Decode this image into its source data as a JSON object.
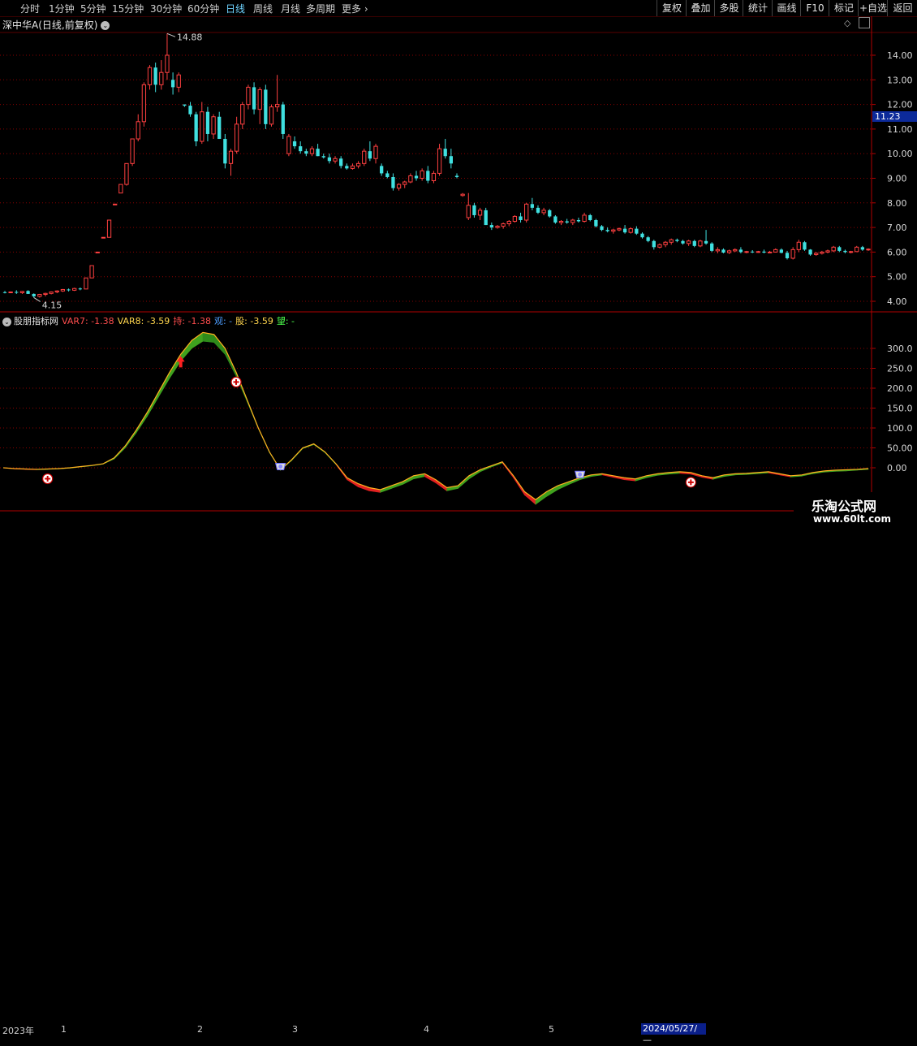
{
  "toolbar": {
    "periods": [
      "分时",
      "1分钟",
      "5分钟",
      "15分钟",
      "30分钟",
      "60分钟",
      "日线",
      "周线",
      "月线",
      "多周期",
      "更多"
    ],
    "active_period": "日线",
    "more_arrow": "›",
    "right_buttons": [
      "复权",
      "叠加",
      "多股",
      "统计",
      "画线",
      "F10",
      "标记",
      "+自选",
      "返回"
    ]
  },
  "chart": {
    "title": "深中华A(日线,前复权)",
    "title_btn": "⌄",
    "price_high_label": "14.88",
    "price_low_label": "4.15",
    "current_price": "11.23",
    "y_ticks": [
      "14.00",
      "13.00",
      "12.00",
      "11.00",
      "10.00",
      "9.00",
      "8.00",
      "7.00",
      "6.00",
      "5.00",
      "4.00"
    ]
  },
  "indicator": {
    "name": "股朋指标网",
    "values": [
      {
        "label": "VAR7: -1.38",
        "color": "#ff4d4d"
      },
      {
        "label": "VAR8: -3.59",
        "color": "#ffd54d"
      },
      {
        "label": "持: -1.38",
        "color": "#ff4d4d"
      },
      {
        "label": "观: -",
        "color": "#4d9dff"
      },
      {
        "label": "股: -3.59",
        "color": "#ffd54d"
      },
      {
        "label": "望: -",
        "color": "#4dff4d"
      }
    ],
    "y_ticks": [
      "300.0",
      "250.0",
      "200.0",
      "150.0",
      "100.0",
      "50.00",
      "0.00"
    ]
  },
  "timeline": {
    "labels": [
      "2023年",
      "1",
      "2",
      "3",
      "4",
      "5"
    ],
    "date": "2024/05/27/—"
  },
  "watermark": {
    "line1": "乐淘公式网",
    "line2": "www.60lt.com"
  },
  "colors": {
    "up": "#ff4040",
    "down": "#40e0e0",
    "grid": "#8b0000",
    "axis": "#b00000"
  },
  "chart_data": {
    "type": "candlestick",
    "title": "深中华A(日线,前复权)",
    "ylim": [
      3.7,
      14.9
    ],
    "candles": [
      {
        "o": 4.37,
        "h": 4.42,
        "l": 4.32,
        "c": 4.36
      },
      {
        "o": 4.36,
        "h": 4.4,
        "l": 4.33,
        "c": 4.38
      },
      {
        "o": 4.38,
        "h": 4.45,
        "l": 4.3,
        "c": 4.35
      },
      {
        "o": 4.35,
        "h": 4.42,
        "l": 4.3,
        "c": 4.4
      },
      {
        "o": 4.42,
        "h": 4.45,
        "l": 4.3,
        "c": 4.3
      },
      {
        "o": 4.3,
        "h": 4.32,
        "l": 4.15,
        "c": 4.2
      },
      {
        "o": 4.2,
        "h": 4.3,
        "l": 4.15,
        "c": 4.28
      },
      {
        "o": 4.28,
        "h": 4.35,
        "l": 4.2,
        "c": 4.32
      },
      {
        "o": 4.32,
        "h": 4.4,
        "l": 4.28,
        "c": 4.38
      },
      {
        "o": 4.38,
        "h": 4.45,
        "l": 4.33,
        "c": 4.42
      },
      {
        "o": 4.42,
        "h": 4.5,
        "l": 4.38,
        "c": 4.48
      },
      {
        "o": 4.48,
        "h": 4.52,
        "l": 4.4,
        "c": 4.45
      },
      {
        "o": 4.45,
        "h": 4.55,
        "l": 4.42,
        "c": 4.52
      },
      {
        "o": 4.52,
        "h": 4.56,
        "l": 4.45,
        "c": 4.5
      },
      {
        "o": 4.5,
        "h": 4.95,
        "l": 4.5,
        "c": 4.95
      },
      {
        "o": 4.95,
        "h": 5.45,
        "l": 4.95,
        "c": 5.45
      },
      {
        "o": 6.0,
        "h": 6.0,
        "l": 5.98,
        "c": 6.0
      },
      {
        "o": 6.6,
        "h": 6.6,
        "l": 6.58,
        "c": 6.6
      },
      {
        "o": 6.6,
        "h": 7.3,
        "l": 6.6,
        "c": 7.3
      },
      {
        "o": 7.95,
        "h": 7.95,
        "l": 7.93,
        "c": 7.95
      },
      {
        "o": 8.4,
        "h": 8.75,
        "l": 8.4,
        "c": 8.75
      },
      {
        "o": 8.75,
        "h": 9.6,
        "l": 8.7,
        "c": 9.6
      },
      {
        "o": 9.6,
        "h": 10.6,
        "l": 9.5,
        "c": 10.6
      },
      {
        "o": 10.6,
        "h": 11.6,
        "l": 10.5,
        "c": 11.3
      },
      {
        "o": 11.3,
        "h": 12.9,
        "l": 11.1,
        "c": 12.8
      },
      {
        "o": 12.8,
        "h": 13.6,
        "l": 12.6,
        "c": 13.5
      },
      {
        "o": 13.5,
        "h": 13.7,
        "l": 12.5,
        "c": 12.8
      },
      {
        "o": 12.8,
        "h": 13.8,
        "l": 12.6,
        "c": 13.3
      },
      {
        "o": 13.3,
        "h": 14.88,
        "l": 13.0,
        "c": 14.0
      },
      {
        "o": 13.0,
        "h": 13.3,
        "l": 12.4,
        "c": 12.7
      },
      {
        "o": 12.7,
        "h": 13.3,
        "l": 12.5,
        "c": 13.2
      },
      {
        "o": 12.0,
        "h": 12.0,
        "l": 11.9,
        "c": 11.95
      },
      {
        "o": 11.95,
        "h": 12.1,
        "l": 11.5,
        "c": 11.6
      },
      {
        "o": 11.6,
        "h": 11.7,
        "l": 10.3,
        "c": 10.5
      },
      {
        "o": 10.5,
        "h": 12.1,
        "l": 10.4,
        "c": 11.7
      },
      {
        "o": 11.7,
        "h": 11.9,
        "l": 10.5,
        "c": 10.8
      },
      {
        "o": 10.8,
        "h": 11.6,
        "l": 10.6,
        "c": 11.5
      },
      {
        "o": 11.5,
        "h": 11.7,
        "l": 10.6,
        "c": 10.6
      },
      {
        "o": 10.6,
        "h": 10.8,
        "l": 9.4,
        "c": 9.6
      },
      {
        "o": 9.6,
        "h": 10.2,
        "l": 9.1,
        "c": 10.1
      },
      {
        "o": 10.1,
        "h": 11.5,
        "l": 10.0,
        "c": 11.2
      },
      {
        "o": 11.2,
        "h": 12.1,
        "l": 11.0,
        "c": 12.0
      },
      {
        "o": 12.0,
        "h": 12.8,
        "l": 11.8,
        "c": 12.7
      },
      {
        "o": 12.7,
        "h": 12.9,
        "l": 11.6,
        "c": 11.8
      },
      {
        "o": 11.8,
        "h": 12.7,
        "l": 11.2,
        "c": 12.6
      },
      {
        "o": 12.6,
        "h": 12.8,
        "l": 11.0,
        "c": 11.2
      },
      {
        "o": 11.2,
        "h": 12.0,
        "l": 11.1,
        "c": 11.9
      },
      {
        "o": 11.9,
        "h": 13.2,
        "l": 11.7,
        "c": 12.0
      },
      {
        "o": 12.0,
        "h": 12.1,
        "l": 10.6,
        "c": 10.8
      },
      {
        "o": 10.0,
        "h": 10.8,
        "l": 9.9,
        "c": 10.7
      },
      {
        "o": 10.5,
        "h": 10.7,
        "l": 10.2,
        "c": 10.3
      },
      {
        "o": 10.3,
        "h": 10.5,
        "l": 10.0,
        "c": 10.1
      },
      {
        "o": 10.1,
        "h": 10.2,
        "l": 9.9,
        "c": 10.0
      },
      {
        "o": 10.0,
        "h": 10.3,
        "l": 9.9,
        "c": 10.2
      },
      {
        "o": 10.2,
        "h": 10.4,
        "l": 9.9,
        "c": 9.9
      },
      {
        "o": 9.9,
        "h": 10.0,
        "l": 9.8,
        "c": 9.85
      },
      {
        "o": 9.85,
        "h": 10.0,
        "l": 9.6,
        "c": 9.7
      },
      {
        "o": 9.7,
        "h": 9.9,
        "l": 9.6,
        "c": 9.8
      },
      {
        "o": 9.8,
        "h": 9.9,
        "l": 9.4,
        "c": 9.5
      },
      {
        "o": 9.5,
        "h": 9.6,
        "l": 9.35,
        "c": 9.4
      },
      {
        "o": 9.4,
        "h": 9.6,
        "l": 9.35,
        "c": 9.5
      },
      {
        "o": 9.5,
        "h": 9.7,
        "l": 9.4,
        "c": 9.6
      },
      {
        "o": 9.6,
        "h": 10.2,
        "l": 9.5,
        "c": 10.1
      },
      {
        "o": 10.1,
        "h": 10.5,
        "l": 9.7,
        "c": 9.8
      },
      {
        "o": 9.8,
        "h": 10.4,
        "l": 9.6,
        "c": 10.3
      },
      {
        "o": 9.5,
        "h": 9.6,
        "l": 9.1,
        "c": 9.2
      },
      {
        "o": 9.2,
        "h": 9.3,
        "l": 9.0,
        "c": 9.05
      },
      {
        "o": 9.05,
        "h": 9.2,
        "l": 8.5,
        "c": 8.6
      },
      {
        "o": 8.6,
        "h": 8.8,
        "l": 8.5,
        "c": 8.75
      },
      {
        "o": 8.75,
        "h": 8.9,
        "l": 8.6,
        "c": 8.85
      },
      {
        "o": 8.85,
        "h": 9.2,
        "l": 8.8,
        "c": 9.1
      },
      {
        "o": 9.1,
        "h": 9.3,
        "l": 8.9,
        "c": 9.0
      },
      {
        "o": 9.0,
        "h": 9.4,
        "l": 8.9,
        "c": 9.3
      },
      {
        "o": 9.3,
        "h": 9.5,
        "l": 8.8,
        "c": 8.9
      },
      {
        "o": 8.9,
        "h": 9.3,
        "l": 8.8,
        "c": 9.2
      },
      {
        "o": 9.2,
        "h": 10.4,
        "l": 9.1,
        "c": 10.2
      },
      {
        "o": 10.2,
        "h": 10.6,
        "l": 9.8,
        "c": 9.9
      },
      {
        "o": 9.9,
        "h": 10.2,
        "l": 9.4,
        "c": 9.6
      },
      {
        "o": 9.1,
        "h": 9.2,
        "l": 9.0,
        "c": 9.05
      },
      {
        "o": 8.3,
        "h": 8.4,
        "l": 8.25,
        "c": 8.35
      },
      {
        "o": 7.4,
        "h": 8.4,
        "l": 7.3,
        "c": 7.9
      },
      {
        "o": 7.9,
        "h": 8.0,
        "l": 7.4,
        "c": 7.5
      },
      {
        "o": 7.5,
        "h": 7.8,
        "l": 7.3,
        "c": 7.7
      },
      {
        "o": 7.7,
        "h": 7.8,
        "l": 7.1,
        "c": 7.1
      },
      {
        "o": 7.1,
        "h": 7.2,
        "l": 6.9,
        "c": 7.0
      },
      {
        "o": 7.0,
        "h": 7.1,
        "l": 6.95,
        "c": 7.05
      },
      {
        "o": 7.05,
        "h": 7.2,
        "l": 6.95,
        "c": 7.15
      },
      {
        "o": 7.15,
        "h": 7.3,
        "l": 7.05,
        "c": 7.25
      },
      {
        "o": 7.25,
        "h": 7.5,
        "l": 7.2,
        "c": 7.45
      },
      {
        "o": 7.45,
        "h": 7.6,
        "l": 7.2,
        "c": 7.3
      },
      {
        "o": 7.3,
        "h": 8.0,
        "l": 7.2,
        "c": 7.95
      },
      {
        "o": 7.95,
        "h": 8.2,
        "l": 7.7,
        "c": 7.8
      },
      {
        "o": 7.8,
        "h": 7.9,
        "l": 7.55,
        "c": 7.6
      },
      {
        "o": 7.6,
        "h": 7.8,
        "l": 7.5,
        "c": 7.7
      },
      {
        "o": 7.7,
        "h": 7.75,
        "l": 7.4,
        "c": 7.45
      },
      {
        "o": 7.45,
        "h": 7.5,
        "l": 7.15,
        "c": 7.2
      },
      {
        "o": 7.2,
        "h": 7.3,
        "l": 7.1,
        "c": 7.25
      },
      {
        "o": 7.25,
        "h": 7.35,
        "l": 7.15,
        "c": 7.2
      },
      {
        "o": 7.2,
        "h": 7.35,
        "l": 7.1,
        "c": 7.3
      },
      {
        "o": 7.3,
        "h": 7.4,
        "l": 7.2,
        "c": 7.25
      },
      {
        "o": 7.25,
        "h": 7.6,
        "l": 7.2,
        "c": 7.5
      },
      {
        "o": 7.5,
        "h": 7.55,
        "l": 7.25,
        "c": 7.3
      },
      {
        "o": 7.3,
        "h": 7.35,
        "l": 7.0,
        "c": 7.05
      },
      {
        "o": 7.05,
        "h": 7.1,
        "l": 6.85,
        "c": 6.9
      },
      {
        "o": 6.9,
        "h": 7.0,
        "l": 6.8,
        "c": 6.85
      },
      {
        "o": 6.85,
        "h": 6.95,
        "l": 6.75,
        "c": 6.9
      },
      {
        "o": 6.9,
        "h": 7.0,
        "l": 6.85,
        "c": 6.95
      },
      {
        "o": 6.95,
        "h": 7.1,
        "l": 6.75,
        "c": 6.8
      },
      {
        "o": 6.8,
        "h": 7.0,
        "l": 6.75,
        "c": 6.95
      },
      {
        "o": 6.95,
        "h": 7.05,
        "l": 6.7,
        "c": 6.75
      },
      {
        "o": 6.75,
        "h": 6.8,
        "l": 6.55,
        "c": 6.6
      },
      {
        "o": 6.6,
        "h": 6.65,
        "l": 6.4,
        "c": 6.45
      },
      {
        "o": 6.45,
        "h": 6.5,
        "l": 6.1,
        "c": 6.2
      },
      {
        "o": 6.2,
        "h": 6.35,
        "l": 6.15,
        "c": 6.3
      },
      {
        "o": 6.3,
        "h": 6.45,
        "l": 6.2,
        "c": 6.4
      },
      {
        "o": 6.4,
        "h": 6.55,
        "l": 6.3,
        "c": 6.5
      },
      {
        "o": 6.5,
        "h": 6.55,
        "l": 6.4,
        "c": 6.45
      },
      {
        "o": 6.45,
        "h": 6.5,
        "l": 6.3,
        "c": 6.35
      },
      {
        "o": 6.35,
        "h": 6.5,
        "l": 6.25,
        "c": 6.45
      },
      {
        "o": 6.45,
        "h": 6.5,
        "l": 6.2,
        "c": 6.25
      },
      {
        "o": 6.25,
        "h": 6.5,
        "l": 6.2,
        "c": 6.45
      },
      {
        "o": 6.45,
        "h": 6.9,
        "l": 6.3,
        "c": 6.35
      },
      {
        "o": 6.35,
        "h": 6.4,
        "l": 6.0,
        "c": 6.05
      },
      {
        "o": 6.05,
        "h": 6.2,
        "l": 5.95,
        "c": 6.1
      },
      {
        "o": 6.1,
        "h": 6.15,
        "l": 5.95,
        "c": 5.98
      },
      {
        "o": 5.98,
        "h": 6.1,
        "l": 5.92,
        "c": 6.05
      },
      {
        "o": 6.05,
        "h": 6.15,
        "l": 6.0,
        "c": 6.1
      },
      {
        "o": 6.1,
        "h": 6.2,
        "l": 5.95,
        "c": 6.0
      },
      {
        "o": 6.0,
        "h": 6.05,
        "l": 5.95,
        "c": 6.02
      },
      {
        "o": 6.02,
        "h": 6.08,
        "l": 5.96,
        "c": 6.0
      },
      {
        "o": 6.0,
        "h": 6.05,
        "l": 5.97,
        "c": 6.02
      },
      {
        "o": 6.02,
        "h": 6.1,
        "l": 5.95,
        "c": 5.98
      },
      {
        "o": 5.98,
        "h": 6.05,
        "l": 5.96,
        "c": 6.0
      },
      {
        "o": 6.0,
        "h": 6.15,
        "l": 5.98,
        "c": 6.1
      },
      {
        "o": 6.1,
        "h": 6.15,
        "l": 5.95,
        "c": 5.97
      },
      {
        "o": 5.97,
        "h": 6.05,
        "l": 5.7,
        "c": 5.75
      },
      {
        "o": 5.75,
        "h": 6.2,
        "l": 5.7,
        "c": 6.1
      },
      {
        "o": 6.1,
        "h": 6.5,
        "l": 6.0,
        "c": 6.4
      },
      {
        "o": 6.4,
        "h": 6.45,
        "l": 6.05,
        "c": 6.1
      },
      {
        "o": 6.1,
        "h": 6.12,
        "l": 5.85,
        "c": 5.9
      },
      {
        "o": 5.9,
        "h": 6.0,
        "l": 5.85,
        "c": 5.95
      },
      {
        "o": 5.95,
        "h": 6.05,
        "l": 5.9,
        "c": 6.0
      },
      {
        "o": 6.0,
        "h": 6.1,
        "l": 5.95,
        "c": 6.05
      },
      {
        "o": 6.05,
        "h": 6.25,
        "l": 6.0,
        "c": 6.2
      },
      {
        "o": 6.2,
        "h": 6.25,
        "l": 6.0,
        "c": 6.05
      },
      {
        "o": 6.05,
        "h": 6.1,
        "l": 5.95,
        "c": 6.0
      },
      {
        "o": 6.0,
        "h": 6.05,
        "l": 5.95,
        "c": 6.02
      },
      {
        "o": 6.02,
        "h": 6.25,
        "l": 6.0,
        "c": 6.2
      },
      {
        "o": 6.2,
        "h": 6.25,
        "l": 6.05,
        "c": 6.1
      },
      {
        "o": 6.1,
        "h": 6.15,
        "l": 6.05,
        "c": 6.12
      }
    ],
    "indicator_ylim": [
      -100,
      360
    ],
    "indicator_series": [
      {
        "name": "VAR7",
        "values": [
          0,
          -2,
          -3,
          -4,
          -3,
          -2,
          0,
          3,
          6,
          10,
          25,
          55,
          95,
          140,
          190,
          240,
          285,
          320,
          340,
          335,
          300,
          240,
          170,
          100,
          40,
          -5,
          20,
          50,
          60,
          40,
          10,
          -25,
          -40,
          -50,
          -55,
          -45,
          -35,
          -20,
          -15,
          -30,
          -50,
          -45,
          -20,
          -5,
          5,
          15,
          -20,
          -60,
          -80,
          -60,
          -45,
          -35,
          -25,
          -18,
          -15,
          -20,
          -25,
          -28,
          -20,
          -15,
          -12,
          -10,
          -12,
          -20,
          -25,
          -18,
          -15,
          -14,
          -12,
          -10,
          -15,
          -20,
          -18,
          -12,
          -8,
          -6,
          -5,
          -4,
          -2
        ]
      },
      {
        "name": "VAR8",
        "values": [
          0,
          -3,
          -4,
          -5,
          -4,
          -3,
          -1,
          2,
          5,
          9,
          22,
          50,
          88,
          130,
          178,
          225,
          268,
          300,
          318,
          315,
          285,
          230,
          165,
          98,
          38,
          -6,
          18,
          48,
          58,
          38,
          8,
          -30,
          -48,
          -58,
          -62,
          -52,
          -42,
          -28,
          -22,
          -38,
          -58,
          -52,
          -28,
          -10,
          2,
          12,
          -25,
          -68,
          -92,
          -72,
          -55,
          -42,
          -30,
          -22,
          -18,
          -24,
          -30,
          -33,
          -25,
          -19,
          -16,
          -14,
          -16,
          -24,
          -29,
          -22,
          -18,
          -17,
          -15,
          -13,
          -18,
          -23,
          -21,
          -15,
          -11,
          -9,
          -8,
          -6,
          -4
        ]
      }
    ],
    "signals": [
      {
        "type": "plus",
        "x": 4
      },
      {
        "type": "arrow-up",
        "x": 16
      },
      {
        "type": "plus",
        "x": 21
      },
      {
        "type": "cup",
        "x": 25
      },
      {
        "type": "cup",
        "x": 52
      },
      {
        "type": "plus",
        "x": 62
      },
      {
        "type": "plus",
        "x": 95
      }
    ]
  }
}
